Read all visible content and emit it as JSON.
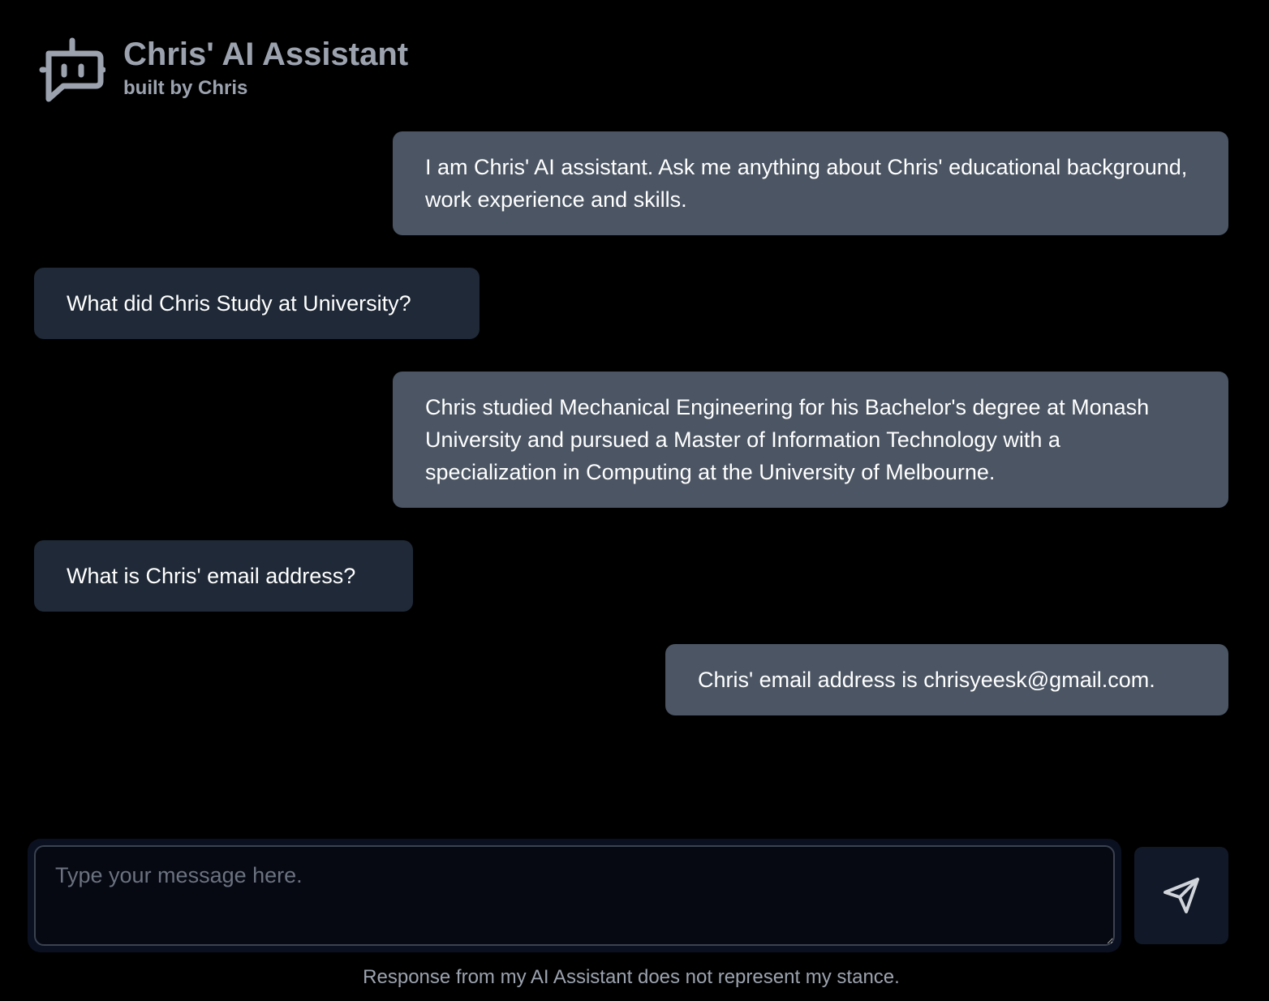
{
  "header": {
    "title": "Chris' AI Assistant",
    "subtitle": "built by Chris",
    "icon": "bot-icon"
  },
  "messages": [
    {
      "role": "assistant",
      "text": "I am Chris' AI assistant. Ask me anything about Chris' educational background, work experience and skills."
    },
    {
      "role": "user",
      "text": "What did Chris Study at University?"
    },
    {
      "role": "assistant",
      "text": "Chris studied Mechanical Engineering for his Bachelor's degree at Monash University and pursued a Master of Information Technology with a specialization in Computing at the University of Melbourne."
    },
    {
      "role": "user",
      "text": "What is Chris' email address?"
    },
    {
      "role": "assistant",
      "text": "Chris' email address is chrisyeesk@gmail.com."
    }
  ],
  "composer": {
    "value": "",
    "placeholder": "Type your message here.",
    "send_icon": "send-icon"
  },
  "footer": {
    "disclaimer": "Response from my AI Assistant does not represent my stance."
  },
  "colors": {
    "background": "#000000",
    "assistant_bubble": "#4b5563",
    "user_bubble": "#1f2937",
    "muted_text": "#9ca3af"
  }
}
